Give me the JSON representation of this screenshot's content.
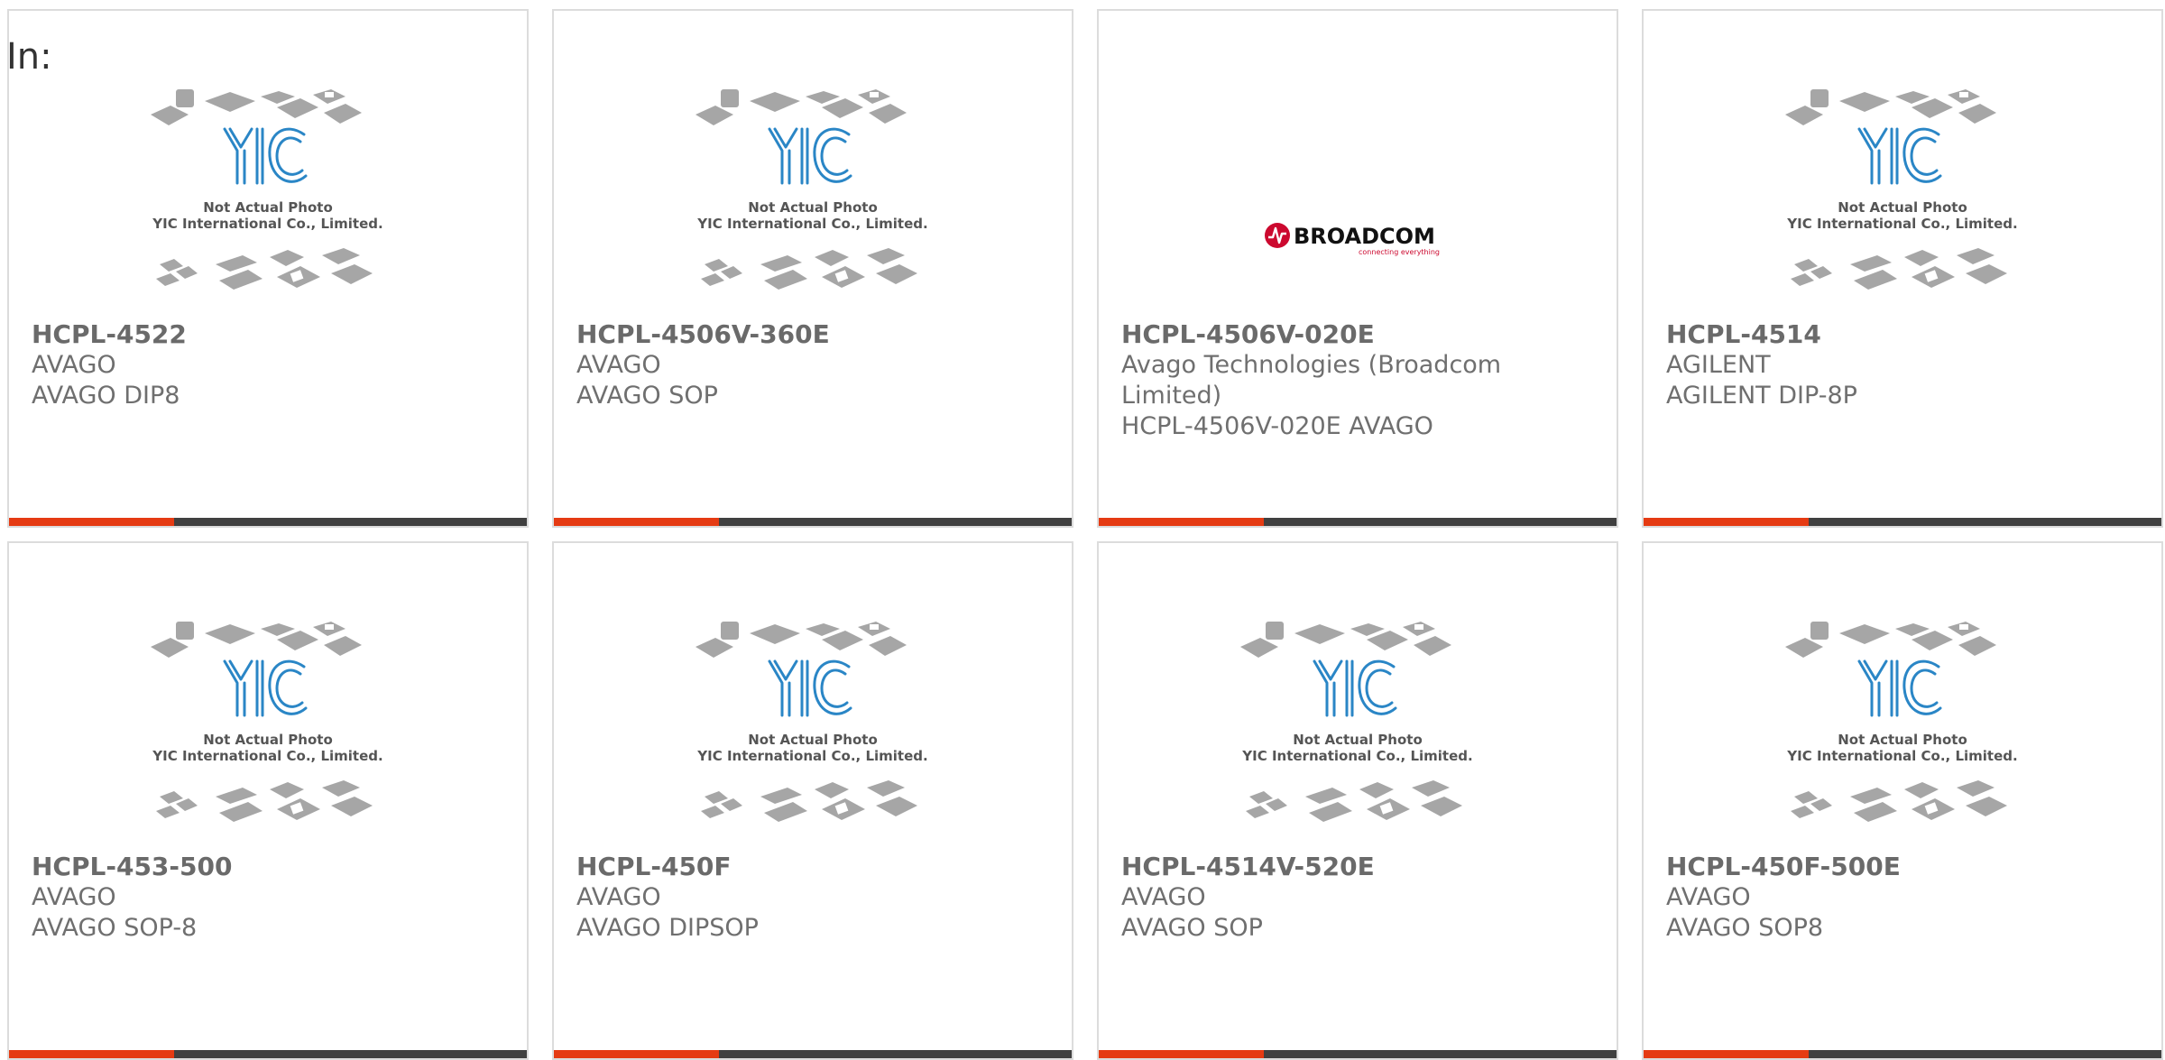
{
  "heading": "In:",
  "placeholder": {
    "line1": "Not Actual Photo",
    "line2": "YIC International Co., Limited.",
    "logo_text": "YIC"
  },
  "broadcom": {
    "name": "BROADCOM",
    "tagline": "connecting everything"
  },
  "colors": {
    "accent": "#e53b13",
    "bar": "#404040",
    "yic_blue": "#1f7fc0"
  },
  "products": [
    {
      "part": "HCPL-4522",
      "maker": "AVAGO",
      "desc": "AVAGO DIP8",
      "image": "yic"
    },
    {
      "part": "HCPL-4506V-360E",
      "maker": "AVAGO",
      "desc": "AVAGO SOP",
      "image": "yic"
    },
    {
      "part": "HCPL-4506V-020E",
      "maker": "Avago Technologies (Broadcom Limited)",
      "desc": "HCPL-4506V-020E AVAGO",
      "image": "broadcom"
    },
    {
      "part": "HCPL-4514",
      "maker": "AGILENT",
      "desc": "AGILENT DIP-8P",
      "image": "yic"
    },
    {
      "part": "HCPL-453-500",
      "maker": "AVAGO",
      "desc": "AVAGO SOP-8",
      "image": "yic"
    },
    {
      "part": "HCPL-450F",
      "maker": "AVAGO",
      "desc": "AVAGO DIPSOP",
      "image": "yic"
    },
    {
      "part": "HCPL-4514V-520E",
      "maker": "AVAGO",
      "desc": "AVAGO SOP",
      "image": "yic"
    },
    {
      "part": "HCPL-450F-500E",
      "maker": "AVAGO",
      "desc": "AVAGO SOP8",
      "image": "yic"
    }
  ]
}
